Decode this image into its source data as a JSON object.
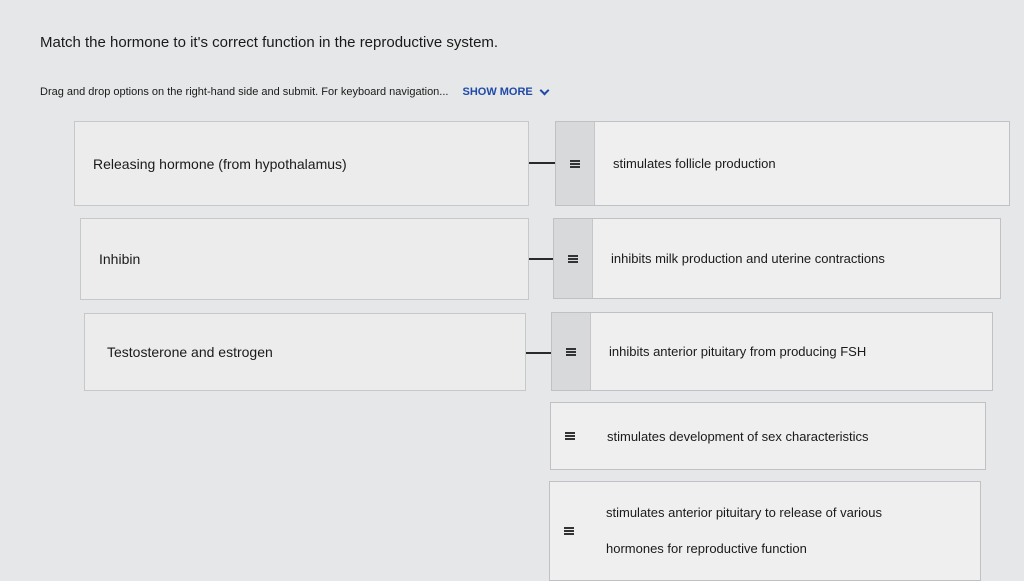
{
  "question": "Match the hormone to it's correct function in the reproductive system.",
  "instructions": {
    "text": "Drag and drop options on the right-hand side and submit. For keyboard navigation...",
    "show_more": "SHOW MORE"
  },
  "targets": [
    {
      "label": "Releasing hormone (from hypothalamus)"
    },
    {
      "label": "Inhibin"
    },
    {
      "label": "Testosterone and estrogen"
    }
  ],
  "options": [
    {
      "label": "stimulates follicle production",
      "placed": true
    },
    {
      "label": "inhibits milk production and uterine contractions",
      "placed": true
    },
    {
      "label": "inhibits anterior pituitary from producing FSH",
      "placed": true
    },
    {
      "label": "stimulates development of sex characteristics",
      "placed": false
    },
    {
      "label": "stimulates anterior pituitary to release of various hormones for reproductive function",
      "placed": false
    }
  ],
  "colors": {
    "link": "#1f4aa8",
    "background": "#e6e7e8"
  }
}
